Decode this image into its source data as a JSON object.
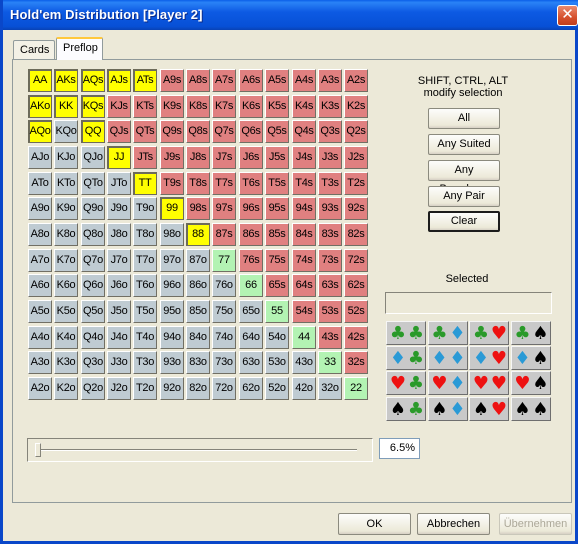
{
  "window": {
    "title": "Hold'em Distribution [Player 2]",
    "close_label": "✕"
  },
  "tabs": [
    {
      "label": "Cards",
      "active": false
    },
    {
      "label": "Preflop",
      "active": true
    }
  ],
  "colors": {
    "selected": "#ffff00",
    "suited": "#e08080",
    "offsuit": "#bfcbd2",
    "pair": "#b3f3b3",
    "suit_club": "#2a9a2a",
    "suit_diamond": "#2a9ad6",
    "suit_heart": "#ee1111",
    "suit_spade": "#000000"
  },
  "hand_grid": {
    "rows": [
      [
        [
          "AA",
          "selected"
        ],
        [
          "AKs",
          "selected"
        ],
        [
          "AQs",
          "selected"
        ],
        [
          "AJs",
          "selected"
        ],
        [
          "ATs",
          "selected"
        ],
        [
          "A9s",
          "suited"
        ],
        [
          "A8s",
          "suited"
        ],
        [
          "A7s",
          "suited"
        ],
        [
          "A6s",
          "suited"
        ],
        [
          "A5s",
          "suited"
        ],
        [
          "A4s",
          "suited"
        ],
        [
          "A3s",
          "suited"
        ],
        [
          "A2s",
          "suited"
        ]
      ],
      [
        [
          "AKo",
          "selected"
        ],
        [
          "KK",
          "selected"
        ],
        [
          "KQs",
          "selected"
        ],
        [
          "KJs",
          "suited"
        ],
        [
          "KTs",
          "suited"
        ],
        [
          "K9s",
          "suited"
        ],
        [
          "K8s",
          "suited"
        ],
        [
          "K7s",
          "suited"
        ],
        [
          "K6s",
          "suited"
        ],
        [
          "K5s",
          "suited"
        ],
        [
          "K4s",
          "suited"
        ],
        [
          "K3s",
          "suited"
        ],
        [
          "K2s",
          "suited"
        ]
      ],
      [
        [
          "AQo",
          "selected"
        ],
        [
          "KQo",
          "offsuit"
        ],
        [
          "QQ",
          "selected"
        ],
        [
          "QJs",
          "suited"
        ],
        [
          "QTs",
          "suited"
        ],
        [
          "Q9s",
          "suited"
        ],
        [
          "Q8s",
          "suited"
        ],
        [
          "Q7s",
          "suited"
        ],
        [
          "Q6s",
          "suited"
        ],
        [
          "Q5s",
          "suited"
        ],
        [
          "Q4s",
          "suited"
        ],
        [
          "Q3s",
          "suited"
        ],
        [
          "Q2s",
          "suited"
        ]
      ],
      [
        [
          "AJo",
          "offsuit"
        ],
        [
          "KJo",
          "offsuit"
        ],
        [
          "QJo",
          "offsuit"
        ],
        [
          "JJ",
          "selected"
        ],
        [
          "JTs",
          "suited"
        ],
        [
          "J9s",
          "suited"
        ],
        [
          "J8s",
          "suited"
        ],
        [
          "J7s",
          "suited"
        ],
        [
          "J6s",
          "suited"
        ],
        [
          "J5s",
          "suited"
        ],
        [
          "J4s",
          "suited"
        ],
        [
          "J3s",
          "suited"
        ],
        [
          "J2s",
          "suited"
        ]
      ],
      [
        [
          "ATo",
          "offsuit"
        ],
        [
          "KTo",
          "offsuit"
        ],
        [
          "QTo",
          "offsuit"
        ],
        [
          "JTo",
          "offsuit"
        ],
        [
          "TT",
          "selected"
        ],
        [
          "T9s",
          "suited"
        ],
        [
          "T8s",
          "suited"
        ],
        [
          "T7s",
          "suited"
        ],
        [
          "T6s",
          "suited"
        ],
        [
          "T5s",
          "suited"
        ],
        [
          "T4s",
          "suited"
        ],
        [
          "T3s",
          "suited"
        ],
        [
          "T2s",
          "suited"
        ]
      ],
      [
        [
          "A9o",
          "offsuit"
        ],
        [
          "K9o",
          "offsuit"
        ],
        [
          "Q9o",
          "offsuit"
        ],
        [
          "J9o",
          "offsuit"
        ],
        [
          "T9o",
          "offsuit"
        ],
        [
          "99",
          "selected"
        ],
        [
          "98s",
          "suited"
        ],
        [
          "97s",
          "suited"
        ],
        [
          "96s",
          "suited"
        ],
        [
          "95s",
          "suited"
        ],
        [
          "94s",
          "suited"
        ],
        [
          "93s",
          "suited"
        ],
        [
          "92s",
          "suited"
        ]
      ],
      [
        [
          "A8o",
          "offsuit"
        ],
        [
          "K8o",
          "offsuit"
        ],
        [
          "Q8o",
          "offsuit"
        ],
        [
          "J8o",
          "offsuit"
        ],
        [
          "T8o",
          "offsuit"
        ],
        [
          "98o",
          "offsuit"
        ],
        [
          "88",
          "selected"
        ],
        [
          "87s",
          "suited"
        ],
        [
          "86s",
          "suited"
        ],
        [
          "85s",
          "suited"
        ],
        [
          "84s",
          "suited"
        ],
        [
          "83s",
          "suited"
        ],
        [
          "82s",
          "suited"
        ]
      ],
      [
        [
          "A7o",
          "offsuit"
        ],
        [
          "K7o",
          "offsuit"
        ],
        [
          "Q7o",
          "offsuit"
        ],
        [
          "J7o",
          "offsuit"
        ],
        [
          "T7o",
          "offsuit"
        ],
        [
          "97o",
          "offsuit"
        ],
        [
          "87o",
          "offsuit"
        ],
        [
          "77",
          "pair"
        ],
        [
          "76s",
          "suited"
        ],
        [
          "75s",
          "suited"
        ],
        [
          "74s",
          "suited"
        ],
        [
          "73s",
          "suited"
        ],
        [
          "72s",
          "suited"
        ]
      ],
      [
        [
          "A6o",
          "offsuit"
        ],
        [
          "K6o",
          "offsuit"
        ],
        [
          "Q6o",
          "offsuit"
        ],
        [
          "J6o",
          "offsuit"
        ],
        [
          "T6o",
          "offsuit"
        ],
        [
          "96o",
          "offsuit"
        ],
        [
          "86o",
          "offsuit"
        ],
        [
          "76o",
          "offsuit"
        ],
        [
          "66",
          "pair"
        ],
        [
          "65s",
          "suited"
        ],
        [
          "64s",
          "suited"
        ],
        [
          "63s",
          "suited"
        ],
        [
          "62s",
          "suited"
        ]
      ],
      [
        [
          "A5o",
          "offsuit"
        ],
        [
          "K5o",
          "offsuit"
        ],
        [
          "Q5o",
          "offsuit"
        ],
        [
          "J5o",
          "offsuit"
        ],
        [
          "T5o",
          "offsuit"
        ],
        [
          "95o",
          "offsuit"
        ],
        [
          "85o",
          "offsuit"
        ],
        [
          "75o",
          "offsuit"
        ],
        [
          "65o",
          "offsuit"
        ],
        [
          "55",
          "pair"
        ],
        [
          "54s",
          "suited"
        ],
        [
          "53s",
          "suited"
        ],
        [
          "52s",
          "suited"
        ]
      ],
      [
        [
          "A4o",
          "offsuit"
        ],
        [
          "K4o",
          "offsuit"
        ],
        [
          "Q4o",
          "offsuit"
        ],
        [
          "J4o",
          "offsuit"
        ],
        [
          "T4o",
          "offsuit"
        ],
        [
          "94o",
          "offsuit"
        ],
        [
          "84o",
          "offsuit"
        ],
        [
          "74o",
          "offsuit"
        ],
        [
          "64o",
          "offsuit"
        ],
        [
          "54o",
          "offsuit"
        ],
        [
          "44",
          "pair"
        ],
        [
          "43s",
          "suited"
        ],
        [
          "42s",
          "suited"
        ]
      ],
      [
        [
          "A3o",
          "offsuit"
        ],
        [
          "K3o",
          "offsuit"
        ],
        [
          "Q3o",
          "offsuit"
        ],
        [
          "J3o",
          "offsuit"
        ],
        [
          "T3o",
          "offsuit"
        ],
        [
          "93o",
          "offsuit"
        ],
        [
          "83o",
          "offsuit"
        ],
        [
          "73o",
          "offsuit"
        ],
        [
          "63o",
          "offsuit"
        ],
        [
          "53o",
          "offsuit"
        ],
        [
          "43o",
          "offsuit"
        ],
        [
          "33",
          "pair"
        ],
        [
          "32s",
          "suited"
        ]
      ],
      [
        [
          "A2o",
          "offsuit"
        ],
        [
          "K2o",
          "offsuit"
        ],
        [
          "Q2o",
          "offsuit"
        ],
        [
          "J2o",
          "offsuit"
        ],
        [
          "T2o",
          "offsuit"
        ],
        [
          "92o",
          "offsuit"
        ],
        [
          "82o",
          "offsuit"
        ],
        [
          "72o",
          "offsuit"
        ],
        [
          "62o",
          "offsuit"
        ],
        [
          "52o",
          "offsuit"
        ],
        [
          "42o",
          "offsuit"
        ],
        [
          "32o",
          "offsuit"
        ],
        [
          "22",
          "pair"
        ]
      ]
    ]
  },
  "side_panel": {
    "hint_line1": "SHIFT, CTRL, ALT",
    "hint_line2": "modify selection",
    "buttons": [
      {
        "label": "All",
        "default": false
      },
      {
        "label": "Any Suited",
        "default": false
      },
      {
        "label": "Any Broadway",
        "default": false
      },
      {
        "label": "Any Pair",
        "default": false
      },
      {
        "label": "Clear",
        "default": true
      }
    ],
    "selected_label": "Selected",
    "selected_value": ""
  },
  "suit_matrix": {
    "symbols": {
      "club": "♣",
      "diamond": "♦",
      "heart": "♥",
      "spade": "♠"
    },
    "order": [
      "club",
      "diamond",
      "heart",
      "spade"
    ]
  },
  "range_slider": {
    "value_percent": 6.5,
    "display": "6.5%"
  },
  "footer": {
    "ok_label": "OK",
    "cancel_label": "Abbrechen",
    "apply_label": "Übernehmen",
    "apply_enabled": false
  }
}
